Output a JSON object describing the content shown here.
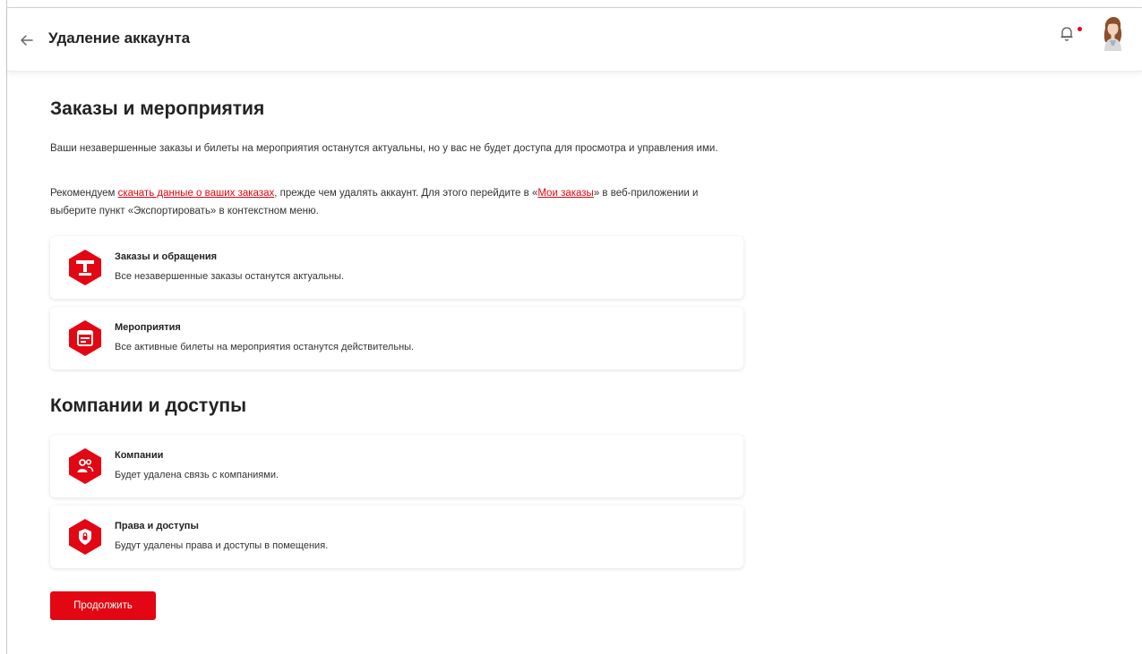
{
  "header": {
    "title": "Удаление аккаунта",
    "back_icon": "arrow-left-icon",
    "bell_icon": "bell-icon",
    "avatar": "user-avatar"
  },
  "section1": {
    "heading": "Заказы и мероприятия",
    "paragraph1": "Ваши незавершенные заказы и билеты на мероприятия останутся актуальны, но у вас не будет доступа для просмотра и управления ими.",
    "paragraph2_part1": "Рекомендуем ",
    "paragraph2_link1": "скачать данные о ваших заказах",
    "paragraph2_part2": ", прежде чем удалять аккаунт. Для этого перейдите в «",
    "paragraph2_link2": "Мои заказы",
    "paragraph2_part3": "» в веб-приложении и выберите пункт «Экспортировать» в контекстном меню.",
    "cards": [
      {
        "title": "Заказы и обращения",
        "desc": "Все незавершенные заказы останутся актуальны.",
        "icon": "orders-icon"
      },
      {
        "title": "Мероприятия",
        "desc": "Все активные билеты на мероприятия останутся действительны.",
        "icon": "calendar-icon"
      }
    ]
  },
  "section2": {
    "heading": "Компании и доступы",
    "cards": [
      {
        "title": "Компании",
        "desc": "Будет удалена связь с компаниями.",
        "icon": "companies-icon"
      },
      {
        "title": "Права и доступы",
        "desc": "Будут удалены права и доступы в помещения.",
        "icon": "shield-icon"
      }
    ]
  },
  "continue_label": "Продолжить",
  "colors": {
    "accent": "#e30613"
  }
}
